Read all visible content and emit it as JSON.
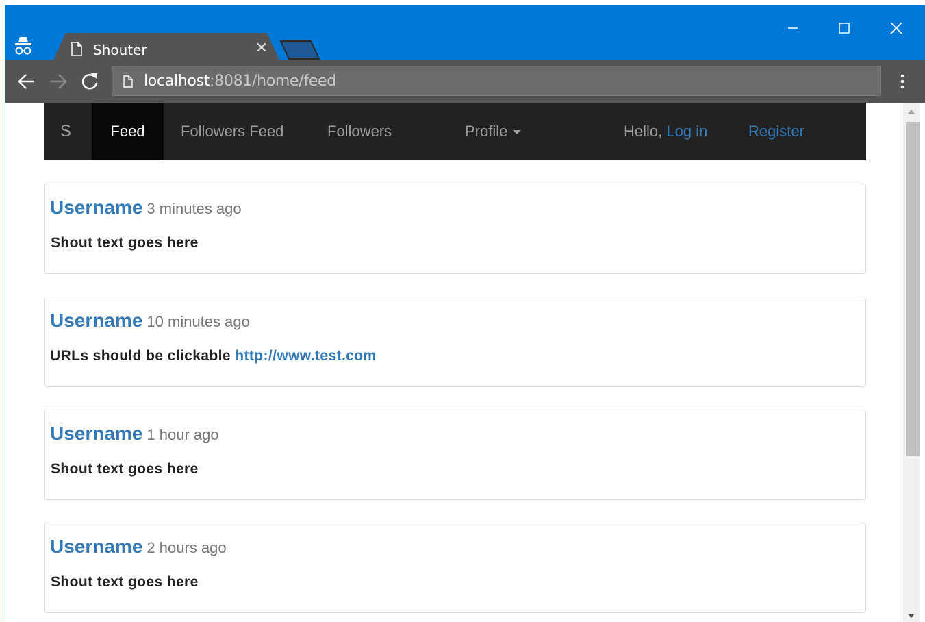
{
  "browser": {
    "tab_title": "Shouter",
    "tab_close": "✕",
    "url_host": "localhost",
    "url_rest": ":8081/home/feed"
  },
  "navbar": {
    "brand": "S",
    "items": [
      {
        "label": "Feed",
        "active": true
      },
      {
        "label": "Followers Feed",
        "active": false
      },
      {
        "label": "Followers",
        "active": false
      }
    ],
    "profile_label": "Profile",
    "hello": "Hello, ",
    "login": "Log in",
    "register": "Register"
  },
  "posts": [
    {
      "username": "Username",
      "time": "3 minutes ago",
      "text": "Shout text goes here",
      "link": ""
    },
    {
      "username": "Username",
      "time": "10 minutes ago",
      "text": "URLs should be clickable ",
      "link": "http://www.test.com"
    },
    {
      "username": "Username",
      "time": "1 hour ago",
      "text": "Shout text goes here",
      "link": ""
    },
    {
      "username": "Username",
      "time": "2 hours ago",
      "text": "Shout text goes here",
      "link": ""
    }
  ],
  "colors": {
    "titlebar": "#0078d7",
    "navbar": "#222222",
    "link": "#337ab7"
  },
  "icons": [
    "incognito-icon",
    "page-icon",
    "close-icon",
    "minimize-icon",
    "maximize-icon",
    "back-arrow-icon",
    "forward-arrow-icon",
    "reload-icon",
    "menu-dots-icon",
    "caret-down-icon"
  ]
}
